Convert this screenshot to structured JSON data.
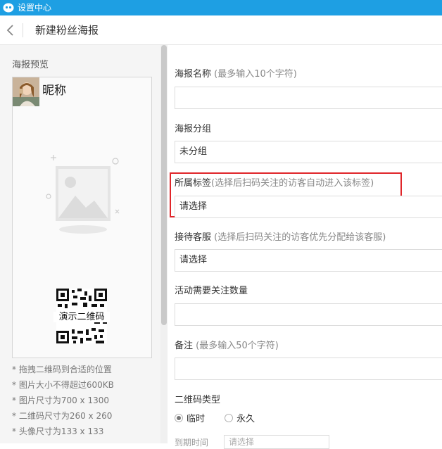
{
  "window": {
    "title": "设置中心"
  },
  "header": {
    "title": "新建粉丝海报"
  },
  "preview": {
    "label": "海报预览",
    "nickname": "昵称",
    "qr_text": "演示二维码",
    "notes": [
      "* 拖拽二维码到合适的位置",
      "* 图片大小不得超过600KB",
      "* 图片尺寸为700 x 1300",
      "* 二维码尺寸为260 x 260",
      "* 头像尺寸为133 x 133"
    ]
  },
  "form": {
    "name": {
      "label": "海报名称",
      "hint": "(最多输入10个字符)",
      "value": ""
    },
    "group": {
      "label": "海报分组",
      "value": "未分组"
    },
    "tag": {
      "label": "所属标签",
      "hint": "(选择后扫码关注的访客自动进入该标签)",
      "value": "请选择"
    },
    "service": {
      "label": "接待客服",
      "hint": "(选择后扫码关注的访客优先分配给该客服)",
      "value": "请选择"
    },
    "follow_count": {
      "label": "活动需要关注数量",
      "value": ""
    },
    "remark": {
      "label": "备注",
      "hint": "(最多输入50个字符)",
      "value": ""
    },
    "qr_type": {
      "label": "二维码类型",
      "options": [
        "临时",
        "永久"
      ],
      "selected": "临时"
    },
    "expire": {
      "label": "到期时间",
      "placeholder": "请选择"
    }
  },
  "colors": {
    "titlebar": "#1e9fe3",
    "highlight": "#e0262a"
  }
}
